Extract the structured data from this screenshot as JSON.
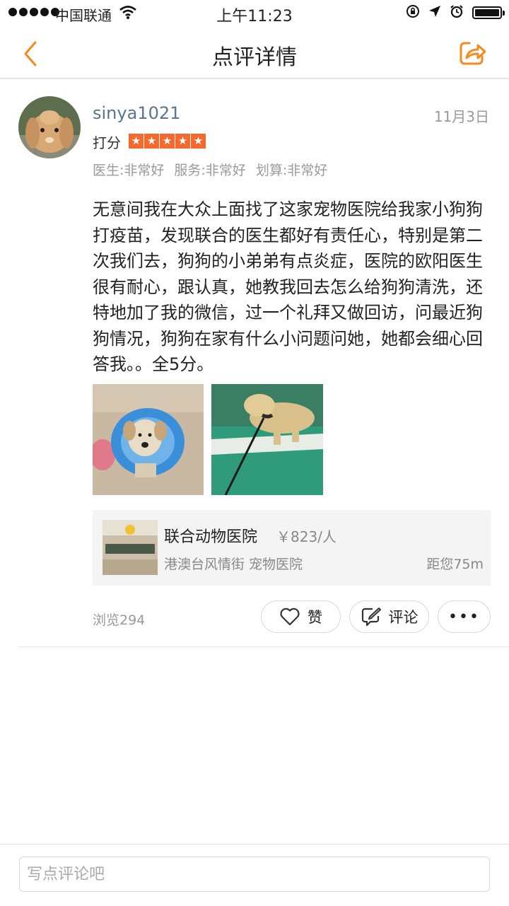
{
  "status_bar": {
    "carrier": "中国联通",
    "time": "上午11:23"
  },
  "nav": {
    "title": "点评详情",
    "back_icon": "chevron-left-icon",
    "share_icon": "share-icon",
    "accent_color": "#f58a1f"
  },
  "review": {
    "username": "sinya1021",
    "date": "11月3日",
    "score_label": "打分",
    "rating": 5,
    "rating_max": 5,
    "star_color": "#f56a2c",
    "subscores": [
      "医生:非常好",
      "服务:非常好",
      "划算:非常好"
    ],
    "text": "无意间我在大众上面找了这家宠物医院给我家小狗狗打疫苗，发现联合的医生都好有责任心，特别是第二次我们去，狗狗的小弟弟有点炎症，医院的欧阳医生很有耐心，跟认真，她教我回去怎么给狗狗清洗，还特地加了我的微信，过一个礼拜又做回访，问最近狗狗情况，狗狗在家有什么小问题问她，她都会细心回答我。。全5分。",
    "photos": [
      "dog-with-cone-photo",
      "dog-on-leash-photo"
    ]
  },
  "shop": {
    "name": "联合动物医院",
    "price": "￥823/人",
    "address": "港澳台风情街 宠物医院",
    "distance": "距您75m"
  },
  "actions": {
    "views": "浏览294",
    "like_label": "赞",
    "comment_label": "评论",
    "more_label": "•••"
  },
  "comment_box": {
    "placeholder": "写点评论吧"
  }
}
